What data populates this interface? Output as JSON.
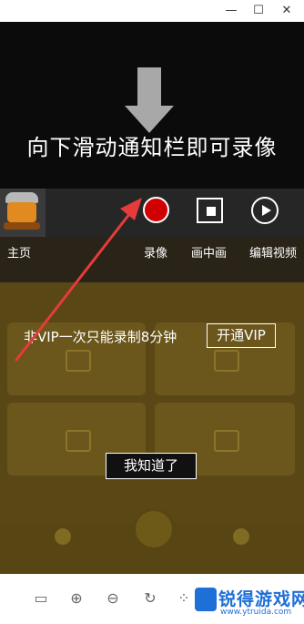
{
  "window_controls": {
    "minimize": "—",
    "maximize": "☐",
    "close": "✕"
  },
  "instruction": {
    "text": "向下滑动通知栏即可录像"
  },
  "toolbar": {
    "home_label": "主页",
    "record_label": "录像",
    "pip_label": "画中画",
    "edit_label": "编辑视频"
  },
  "vip_banner": {
    "text": "非VIP一次只能录制8分钟",
    "button_label": "开通VIP"
  },
  "dialog": {
    "ok_label": "我知道了"
  },
  "colors": {
    "record_red": "#d10000",
    "overlay_dark": "#0b0b0b",
    "app_gold": "#5a4716",
    "watermark_blue": "#1e6fd6",
    "annotation_arrow": "#e53b3b"
  },
  "viewer_toolbar": {
    "icons": [
      "layout-icon",
      "zoom-in-icon",
      "zoom-out-icon",
      "rotate-icon",
      "loading-icon"
    ]
  },
  "watermark": {
    "title": "锐得游戏网",
    "url": "www.ytruida.com"
  }
}
